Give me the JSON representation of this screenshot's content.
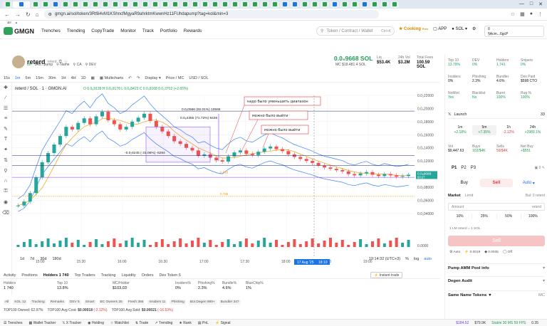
{
  "browser": {
    "url": "gmgn.ai/sol/token/3Rt9i4vM1KShncfMgyaR9ahrktmKwwnHz11FUhdapump?tag=kol&min=3",
    "tabs_favicon_colors": [
      "#2e9e4f",
      "#1a73e8",
      "#2e9e4f",
      "#2e9e4f",
      "#1a73e8",
      "#2e9e4f",
      "#2e9e4f",
      "#2e9e4f",
      "#2e9e4f",
      "#2e9e4f",
      "#2e9e4f",
      "#2e9e4f",
      "#2e9e4f",
      "#2e9e4f",
      "#2e9e4f",
      "#2e9e4f",
      "#2e9e4f",
      "#2e9e4f",
      "#2e9e4f",
      "#2e9e4f",
      "#2e9e4f",
      "#2e9e4f",
      "#2e9e4f",
      "#2e9e4f",
      "#2e9e4f",
      "#2e9e4f",
      "#2e9e4f",
      "#1a73e8",
      "#1a73e8",
      "#2e9e4f",
      "#2e9e4f",
      "#2e9e4f",
      "#1a73e8",
      "#2e9e4f",
      "#2e9e4f",
      "#1a73e8",
      "#2e9e4f",
      "#2e9e4f",
      "#2e9e4f"
    ],
    "bookmark_all": "All"
  },
  "site": {
    "logo": "GMGN",
    "nav": [
      "Trenches",
      "Trending",
      "CopyTrade",
      "Monitor",
      "Track",
      "Portfolio",
      "Rewards"
    ],
    "search_placeholder": "Token / Contract / Wallet",
    "search_kbd": "Ctrl+K",
    "cooking": "Cooking",
    "cooking_badge": "Free",
    "app": "APP",
    "chain": "SOL",
    "wallet_balance": "0",
    "wallet_name": "§Acm...6gcP"
  },
  "token": {
    "name": "reterd",
    "sub": "reterd",
    "age": "6h",
    "contract": "3Rti...pump",
    "name_btn": "Name",
    "ca_btn": "CA",
    "dev_btn": "DEV",
    "price": "0.0₉9668 SOL",
    "mc_label": "MC",
    "mc": "$18.481.4 SOL",
    "liq_label": "Liq",
    "liq": "$53.4K",
    "vol_label": "24h Vol",
    "vol": "$3.2M",
    "fees_label": "Total Fees",
    "fees": "100.59 SOL"
  },
  "chart_toolbar": {
    "intervals": [
      "15s",
      "1m",
      "5m",
      "15m",
      "30m",
      "1H",
      "4H",
      "1D"
    ],
    "active": "1m",
    "multicharts": "Multicharts",
    "display": "Display",
    "price_mc": "Price / MC",
    "usd_sol": "USD / SOL"
  },
  "chart_data": {
    "type": "line",
    "title": "reterd / SOL · 1 · GMGN.AI",
    "ohlc": "O 0.0₈9139  H 0.0₉9178  L 0.0₈8423  C 0.0₉9168  0.0₂3702 (+2.65%)",
    "x_ticks": [
      "15:00",
      "15:30",
      "16:00",
      "16:30",
      "17:00",
      "17:30",
      "18:00",
      "18:30",
      "19:00"
    ],
    "y_ticks": [
      "0.0₂22000",
      "0.0₂20000",
      "0.0₂18000",
      "0.0₂16000",
      "0.0₂14000",
      "0.0₂12000",
      "0.0₂10000",
      "0.0₂08000",
      "0.0₂06000",
      "0.0₂04000"
    ],
    "volume_tick": "0.0000",
    "last_price": "0.0₉9668",
    "last_time": "00:27",
    "cursor_date": "17 Aug '25",
    "cursor_time": "18:10",
    "price_series": [
      0.052,
      0.058,
      0.071,
      0.095,
      0.118,
      0.132,
      0.145,
      0.158,
      0.172,
      0.168,
      0.178,
      0.185,
      0.176,
      0.188,
      0.195,
      0.182,
      0.176,
      0.168,
      0.172,
      0.18,
      0.186,
      0.192,
      0.181,
      0.172,
      0.165,
      0.158,
      0.15,
      0.146,
      0.14,
      0.136,
      0.128,
      0.13,
      0.125,
      0.121,
      0.119,
      0.127,
      0.133,
      0.136,
      0.131,
      0.129,
      0.134,
      0.139,
      0.142,
      0.138,
      0.135,
      0.13,
      0.126,
      0.123,
      0.12,
      0.117,
      0.113,
      0.11,
      0.108,
      0.106,
      0.104,
      0.1,
      0.098,
      0.101,
      0.103,
      0.099,
      0.097,
      0.1,
      0.098,
      0.096,
      0.097,
      0.099
    ],
    "annotations": [
      {
        "label": "0.0₁0566 (92.01%) 10566"
      },
      {
        "label": "0.0₈4355 (71.72%) 8436"
      },
      {
        "label": "-0.0₂6245 (-31.06%) -6264"
      },
      {
        "label": "надо было уменьшить диапазон"
      },
      {
        "label": "можно было выйти"
      },
      {
        "label": "можно было выйти"
      }
    ],
    "fib_levels": [
      "0.618",
      "0.786"
    ],
    "grid": true
  },
  "chart_bottom": {
    "ranges": [
      "1d",
      "7d",
      "30d",
      "180d"
    ],
    "clock": "19:14:32 (UTC+3)",
    "pct": "%",
    "log": "log",
    "auto": "auto"
  },
  "bottom": {
    "tabs": [
      "Activity",
      "Positions",
      "Holders 1 740",
      "Top Traders",
      "Tracking",
      "Liquidity",
      "Orders",
      "Dev Token 6"
    ],
    "active_tab": "Holders 1 740",
    "instant_trade": "Instant trade",
    "holder_stats": [
      {
        "label": "Holders",
        "value": "1 740"
      },
      {
        "label": "Top 10",
        "value": "13.8%"
      },
      {
        "label": "MC/Holder",
        "value": "$103,03"
      },
      {
        "label": "Insiders%",
        "value": "0%"
      },
      {
        "label": "Phishing%",
        "value": "2.3%"
      },
      {
        "label": "Bundle%",
        "value": "4.6%"
      },
      {
        "label": "BlueChip%",
        "value": "1%"
      }
    ],
    "filters": [
      "All",
      "KOL 12",
      "Tracking",
      "Remarks",
      "DEV 5",
      "Smart",
      "BC Owners 25",
      "Fresh 366",
      "Insiders 11",
      "Phishing",
      "Bot Degen 999+",
      "Bundler 347"
    ],
    "top100_owned": "TOP100 Owned: 62.97%",
    "top100_avg_cost_label": "TOP100 Avg Cost:",
    "top100_avg_cost": "$0.00018",
    "top100_avg_cost_chg": "(-2.12%)",
    "top100_avg_sold_label": "TOP100 Avg Sold:",
    "top100_avg_sold": "$0.00021",
    "top100_avg_sold_chg": "(-16.53%)"
  },
  "footer": {
    "items": [
      "Trenches",
      "Wallet Tracker",
      "X Tracker",
      "Holding",
      "Watchlist",
      "Trade",
      "Trending",
      "Rank",
      "PnL",
      "Signal"
    ],
    "sol_price": "$184.52",
    "eth_price": "$79.9K",
    "status": "Stable 30 MS  59 FPS",
    "zoom": "0.35"
  },
  "right": {
    "row1": [
      {
        "l": "Top 10",
        "v": "13.79%"
      },
      {
        "l": "DEV",
        "v": "0%"
      },
      {
        "l": "Holders",
        "v": "1,741"
      },
      {
        "l": "Snipers",
        "v": "0%"
      }
    ],
    "row2": [
      {
        "l": "Insiders",
        "v": "0%"
      },
      {
        "l": "Phishing",
        "v": "2.3%"
      },
      {
        "l": "Bundler",
        "v": "4.6%"
      },
      {
        "l": "Dex Paid",
        "v": "$598 CTO"
      }
    ],
    "row3": [
      {
        "l": "NoMint",
        "v": "Yes"
      },
      {
        "l": "Blacklist",
        "v": "No"
      },
      {
        "l": "Burnt",
        "v": "100%"
      },
      {
        "l": "Rug %",
        "v": "100%"
      }
    ],
    "launch": "Launch",
    "launch_count": "33",
    "periods": [
      {
        "l": "1m",
        "v": "+2.18%"
      },
      {
        "l": "5m",
        "v": "+7.35%"
      },
      {
        "l": "1h",
        "v": "-2.12%"
      },
      {
        "l": "24h",
        "v": "+2989.1%"
      }
    ],
    "active_period": "5m",
    "vols": [
      {
        "l": "Vol",
        "v": "$9,447.63"
      },
      {
        "l": "Buys",
        "v": "102/$4K"
      },
      {
        "l": "Sells",
        "v": "59/$4K"
      },
      {
        "l": "Net Buy",
        "v": "+$551"
      }
    ],
    "presets": [
      "P1",
      "P2",
      "P3"
    ],
    "preset_bal": "0",
    "buy": "Buy",
    "sell": "Sell",
    "auto": "Auto",
    "market": "Market",
    "limit": "Limit",
    "bal": "Bal: 0 reterd",
    "amount_placeholder": "Amount",
    "amount_unit": "reterd",
    "pcts": [
      "10%",
      "25%",
      "50%",
      "100%"
    ],
    "note": "1 LM reterd = 1 SOL",
    "sell_big": "Sell",
    "settings": [
      "Auto",
      "0.0019",
      "0.0035",
      "Off"
    ],
    "sections": [
      "Pump AMM Pool info",
      "Degen Audit",
      "Same Name Tokens"
    ],
    "same_name_count": "MC"
  }
}
